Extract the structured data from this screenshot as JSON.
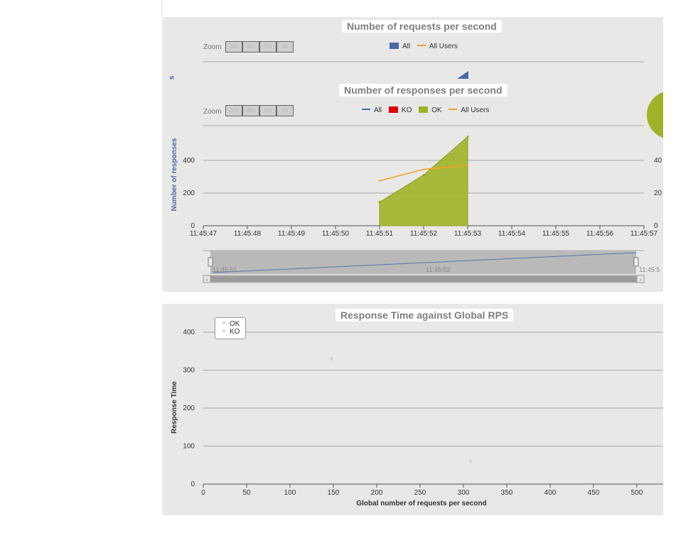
{
  "charts": {
    "requests": {
      "title": "Number of requests per second",
      "zoom_label": "Zoom",
      "zoom_buttons": [
        "10s",
        "30s",
        "1m",
        "All"
      ],
      "legend": [
        {
          "label": "All",
          "kind": "box",
          "color": "#4a69a8"
        },
        {
          "label": "All Users",
          "kind": "line",
          "color": "#f0a12a"
        }
      ],
      "side_label": "s"
    },
    "responses": {
      "title": "Number of responses per second",
      "zoom_label": "Zoom",
      "zoom_buttons": [
        "10s",
        "30s",
        "1m",
        "All"
      ],
      "legend": [
        {
          "label": "All",
          "kind": "line",
          "color": "#4a69a8"
        },
        {
          "label": "KO",
          "kind": "box",
          "color": "#e00000"
        },
        {
          "label": "OK",
          "kind": "box",
          "color": "#a0b228"
        },
        {
          "label": "All Users",
          "kind": "line",
          "color": "#f0a12a"
        }
      ],
      "navigator_labels": [
        "11:45:51",
        "11:45:52",
        "11:45:5"
      ]
    },
    "scatter": {
      "title": "Response Time against Global RPS",
      "legend": [
        "OK",
        "KO"
      ]
    }
  },
  "chart_data": [
    {
      "type": "area",
      "title": "Number of responses per second",
      "xlabel": "",
      "ylabel": "Number of responses",
      "x": [
        "11:45:47",
        "11:45:48",
        "11:45:49",
        "11:45:50",
        "11:45:51",
        "11:45:52",
        "11:45:53",
        "11:45:54",
        "11:45:55",
        "11:45:56",
        "11:45:57"
      ],
      "ylim": [
        0,
        600
      ],
      "yticks": [
        0,
        200,
        400
      ],
      "right_yticks": [
        "0",
        "20",
        "40"
      ],
      "grid": true,
      "legend_position": "top",
      "series": [
        {
          "name": "OK",
          "kind": "area",
          "color": "#a0b228",
          "x": [
            "11:45:51",
            "11:45:52",
            "11:45:53"
          ],
          "values": [
            145,
            310,
            545
          ]
        },
        {
          "name": "All Users",
          "kind": "line",
          "color": "#f0a12a",
          "x": [
            "11:45:51",
            "11:45:52",
            "11:45:53"
          ],
          "values": [
            275,
            345,
            370
          ]
        }
      ]
    },
    {
      "type": "scatter",
      "title": "Response Time against Global RPS",
      "xlabel": "Global number of requests per second",
      "ylabel": "Response Time",
      "xlim": [
        0,
        500
      ],
      "ylim": [
        0,
        400
      ],
      "xticks": [
        0,
        50,
        100,
        150,
        200,
        250,
        300,
        350,
        400,
        450,
        500
      ],
      "yticks": [
        0,
        100,
        200,
        300,
        400
      ],
      "grid": true,
      "legend_position": "top-left",
      "series": [
        {
          "name": "OK",
          "color": "#d6d6d6",
          "points": [
            [
              148,
              330
            ],
            [
              308,
              60
            ]
          ]
        },
        {
          "name": "KO",
          "color": "#d6d6d6",
          "points": []
        }
      ]
    }
  ]
}
